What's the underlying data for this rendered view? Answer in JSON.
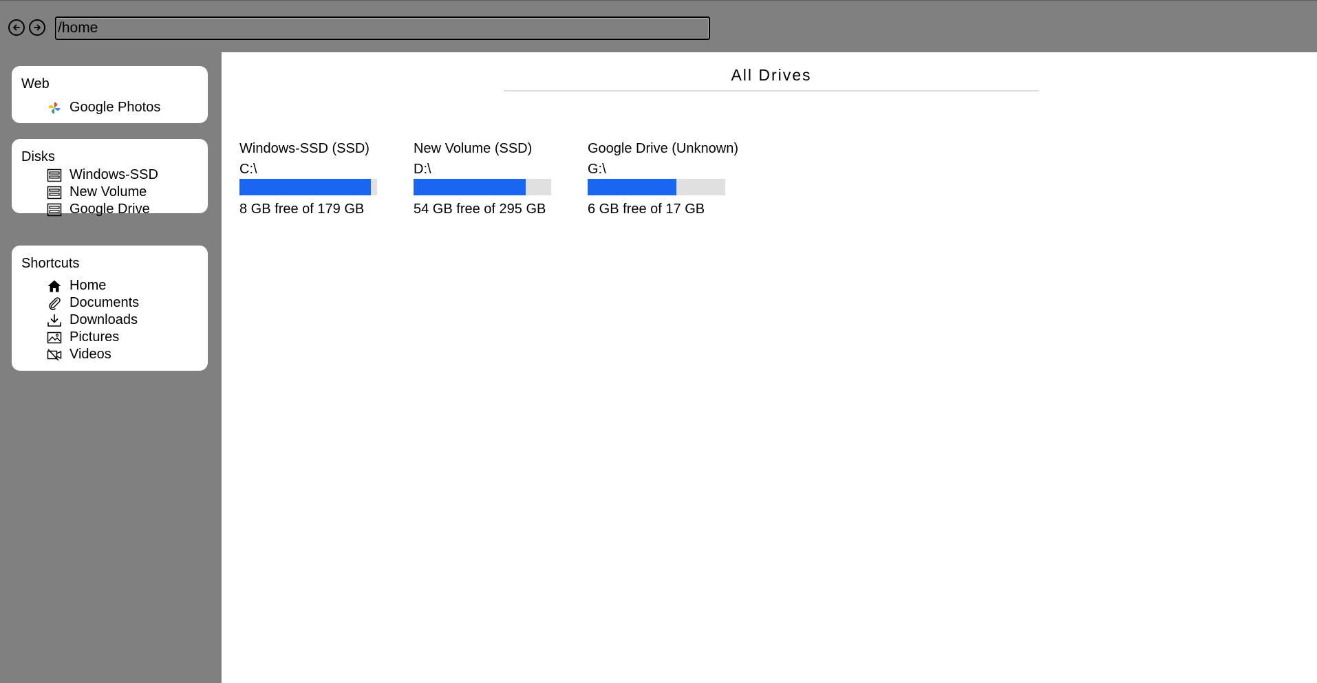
{
  "toolbar": {
    "path_value": "/home",
    "back_icon": "arrow-left-circle-icon",
    "forward_icon": "arrow-right-circle-icon"
  },
  "sidebar": {
    "web": {
      "title": "Web",
      "items": [
        {
          "label": "Google Photos",
          "icon": "google-photos-icon"
        }
      ]
    },
    "disks": {
      "title": "Disks",
      "items": [
        {
          "label": "Windows-SSD",
          "icon": "drive-icon"
        },
        {
          "label": "New Volume",
          "icon": "drive-icon"
        },
        {
          "label": "Google Drive",
          "icon": "drive-icon"
        }
      ]
    },
    "shortcuts": {
      "title": "Shortcuts",
      "items": [
        {
          "label": "Home",
          "icon": "home-icon"
        },
        {
          "label": "Documents",
          "icon": "paperclip-icon"
        },
        {
          "label": "Downloads",
          "icon": "download-icon"
        },
        {
          "label": "Pictures",
          "icon": "image-icon"
        },
        {
          "label": "Videos",
          "icon": "video-off-icon"
        }
      ]
    }
  },
  "main": {
    "title": "All Drives",
    "drives": [
      {
        "name": "Windows-SSD (SSD)",
        "letter": "C:\\",
        "free_text": "8 GB free of 179 GB",
        "used_fraction": 0.955
      },
      {
        "name": "New Volume (SSD)",
        "letter": "D:\\",
        "free_text": "54 GB free of 295 GB",
        "used_fraction": 0.817
      },
      {
        "name": "Google Drive (Unknown)",
        "letter": "G:\\",
        "free_text": "6 GB free of 17 GB",
        "used_fraction": 0.647
      }
    ]
  },
  "colors": {
    "chrome": "#808080",
    "panel": "#ffffff",
    "bar_fill": "#1a66f0",
    "bar_track": "#e0e0e0"
  }
}
